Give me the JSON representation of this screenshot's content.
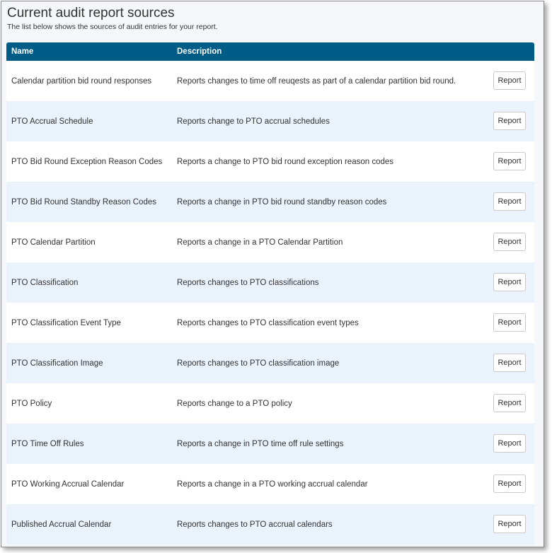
{
  "header": {
    "title": "Current audit report sources",
    "subtitle": "The list below shows the sources of audit entries for your report."
  },
  "table": {
    "columns": [
      "Name",
      "Description"
    ],
    "button_label": "Report",
    "rows": [
      {
        "name": "Calendar partition bid round responses",
        "description": "Reports changes to time off reuqests as part of a calendar partition bid round."
      },
      {
        "name": "PTO Accrual Schedule",
        "description": "Reports change to PTO accrual schedules"
      },
      {
        "name": "PTO Bid Round Exception Reason Codes",
        "description": "Reports a change to PTO bid round exception reason codes"
      },
      {
        "name": "PTO Bid Round Standby Reason Codes",
        "description": "Reports a change in PTO bid round standby reason codes"
      },
      {
        "name": "PTO Calendar Partition",
        "description": "Reports a change in a PTO Calendar Partition"
      },
      {
        "name": "PTO Classification",
        "description": "Reports changes to PTO classifications"
      },
      {
        "name": "PTO Classification Event Type",
        "description": "Reports changes to PTO classification event types"
      },
      {
        "name": "PTO Classification Image",
        "description": "Reports changes to PTO classification image"
      },
      {
        "name": "PTO Policy",
        "description": "Reports change to a PTO policy"
      },
      {
        "name": "PTO Time Off Rules",
        "description": "Reports a change in PTO time off rule settings"
      },
      {
        "name": "PTO Working Accrual Calendar",
        "description": "Reports a change in a PTO working accrual calendar"
      },
      {
        "name": "Published Accrual Calendar",
        "description": "Reports changes to PTO accrual calendars"
      }
    ]
  },
  "colors": {
    "header_bg": "#005b86",
    "row_alt_bg": "#eaf2fb",
    "page_bg": "#f5f7fb"
  }
}
